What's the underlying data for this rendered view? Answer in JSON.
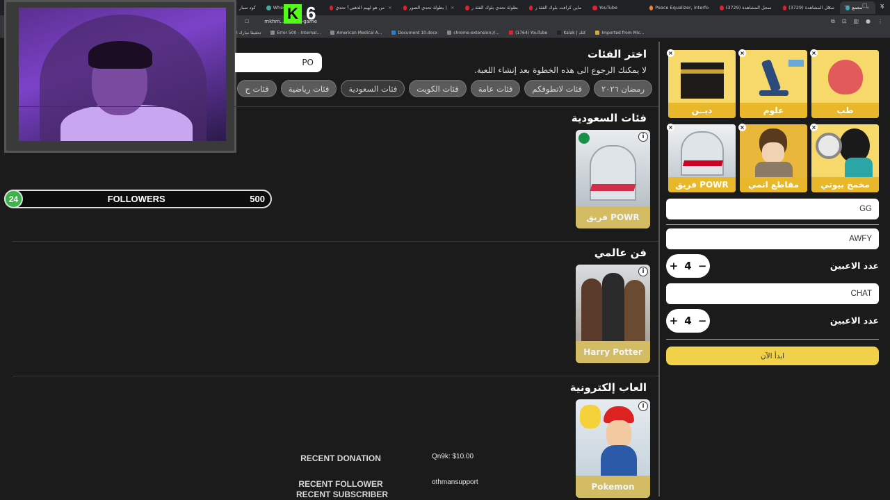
{
  "browser": {
    "tabs": [
      {
        "title": "كود سبار"
      },
      {
        "title": "Wheel of N"
      },
      {
        "title": "من هو لهيم الذهبي؟ تحدي"
      },
      {
        "title": "بطولة تحدي الصور |"
      },
      {
        "title": "بطولة تحدي بلوك الفئة ر"
      },
      {
        "title": "ماين كرافت بلوك الفئة ر"
      },
      {
        "title": "YouTube"
      },
      {
        "title": "Peace Equalizer, interfo"
      },
      {
        "title": "(3729) سجل المشاهدة"
      },
      {
        "title": "(3729) سجل المشاهدة"
      },
      {
        "title": "مجمع"
      }
    ],
    "url": "mkhm.../create-game",
    "bookmarks": [
      "تحقيقا مبارك ا",
      "Error 500 - Internal...",
      "American Medical A...",
      "Document 10.docx",
      "chrome-extension://...",
      "(1764) YouTube",
      "Kalak | كلك",
      "Imported from Mic..."
    ]
  },
  "overlay": {
    "kick_letter": "K",
    "kick_number": "6",
    "followers_count": "24",
    "followers_label": "FOLLOWERS",
    "followers_goal": "500",
    "recent_donation_label": "RECENT DONATION",
    "recent_donation_value": "Qn9k: $10.00",
    "recent_follower_label": "RECENT FOLLOWER",
    "recent_follower_value": "othmansupport",
    "recent_subscriber_label": "RECENT SUBSCRIBER"
  },
  "main": {
    "title": "اختر الفئات",
    "subtitle": "لا يمكنك الرجوع الى هذه الخطوة بعد إنشاء اللعبة.",
    "search_value": "PO",
    "chips": [
      "رمضان ٢٠٢٦",
      "فئات لاتطوفكم",
      "فئات عامة",
      "فئات الكويت",
      "فئات السعودية",
      "فئات رياضية",
      "فئات ح"
    ],
    "sections": [
      {
        "title": "فئات السعودية",
        "card_label": "فريق POWR"
      },
      {
        "title": "فن عالمي",
        "card_label": "Harry Potter"
      },
      {
        "title": "العاب إلكترونية",
        "card_label": "Pokemon"
      }
    ]
  },
  "panel": {
    "selected": [
      {
        "label": "طب"
      },
      {
        "label": "علوم"
      },
      {
        "label": "ديــن"
      },
      {
        "label": "مخمخ بيوتي"
      },
      {
        "label": "مقاطع انمي"
      },
      {
        "label": "فريق POWR"
      }
    ],
    "team1_name": "GG",
    "team2_name": "AWFY",
    "players_label_1": "عدد الاعبين",
    "players_1": "4",
    "team3_name": "CHAT",
    "players_label_2": "عدد الاعبين",
    "players_2": "4",
    "start_label": "ابدأ الآن",
    "plus": "+",
    "minus": "−",
    "remove": "×"
  }
}
